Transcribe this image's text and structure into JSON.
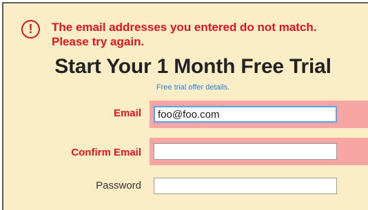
{
  "error": {
    "icon": "exclamation-circle-icon",
    "message": "The email addresses you entered do not match. Please try again."
  },
  "headline": "Start Your 1 Month Free Trial",
  "offer_link": "Free trial offer details.",
  "form": {
    "email_label": "Email",
    "email_value": "foo@foo.com",
    "confirm_email_label": "Confirm Email",
    "confirm_email_value": "",
    "password_label": "Password",
    "password_value": ""
  },
  "colors": {
    "background": "#fbedc6",
    "error": "#e0141e",
    "error_highlight": "#f7a6a3",
    "link": "#2a82d6"
  }
}
